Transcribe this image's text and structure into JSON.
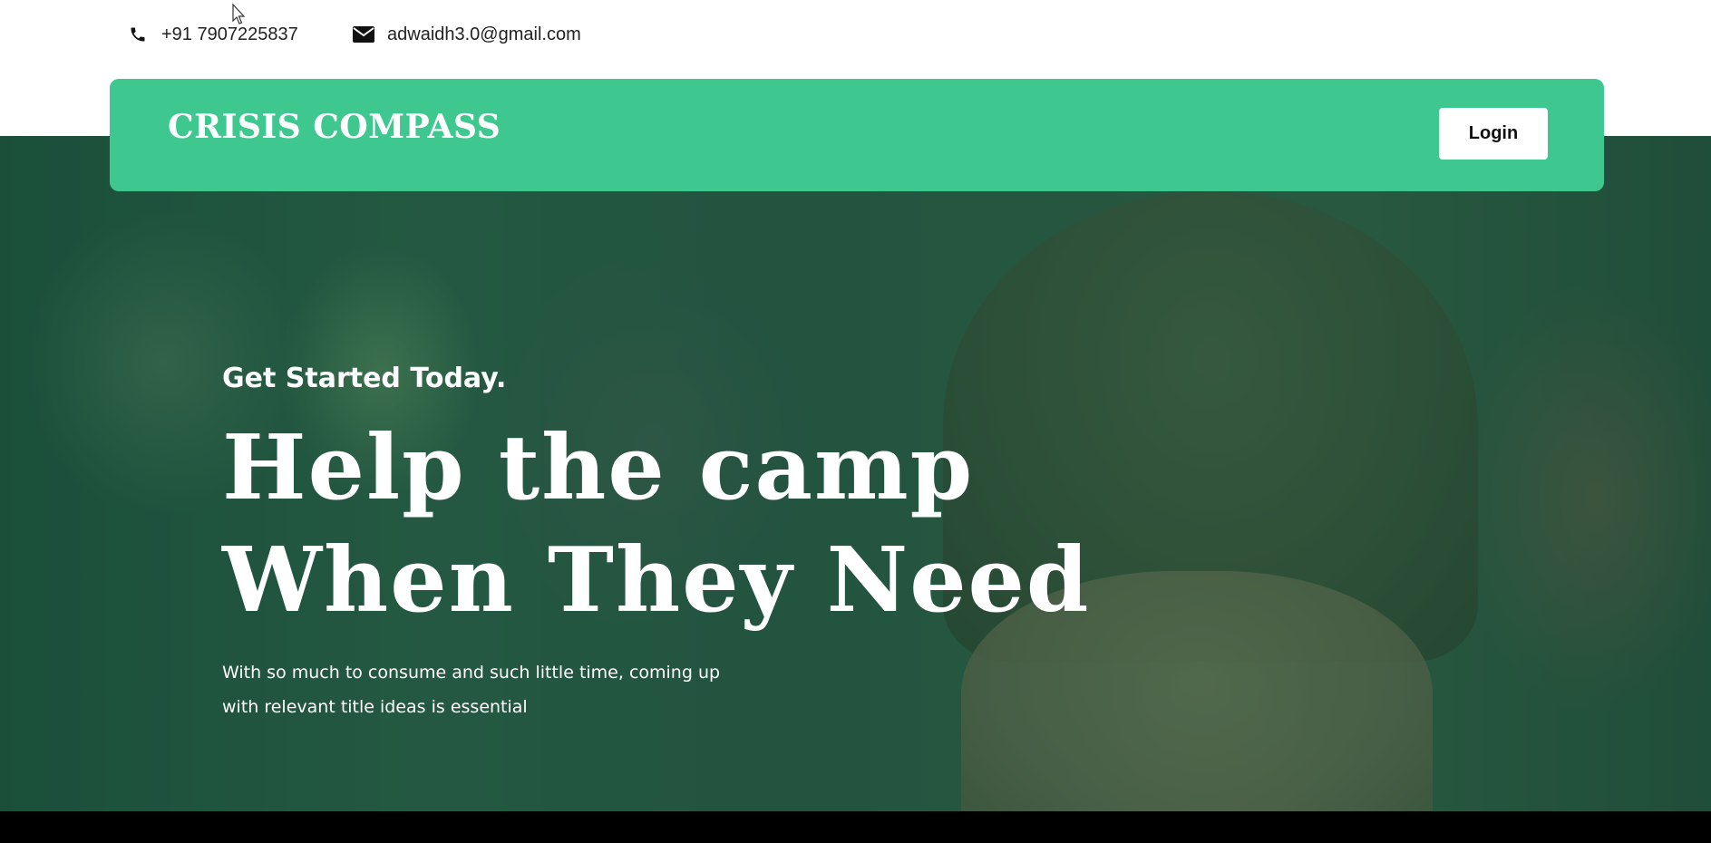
{
  "topbar": {
    "phone": "+91 7907225837",
    "email": "adwaidh3.0@gmail.com",
    "phone_icon": "phone-icon",
    "email_icon": "envelope-icon"
  },
  "navbar": {
    "brand": "CRISIS COMPASS",
    "login_label": "Login"
  },
  "hero": {
    "kicker": "Get Started Today.",
    "headline_line1": "Help the camp",
    "headline_line2": "When They Need",
    "subtext": "With so much to consume and such little time, coming up with relevant title ideas is essential"
  },
  "colors": {
    "accent": "#3ec88f",
    "hero_tint": "#1f5a43",
    "text_light": "#ffffff"
  }
}
